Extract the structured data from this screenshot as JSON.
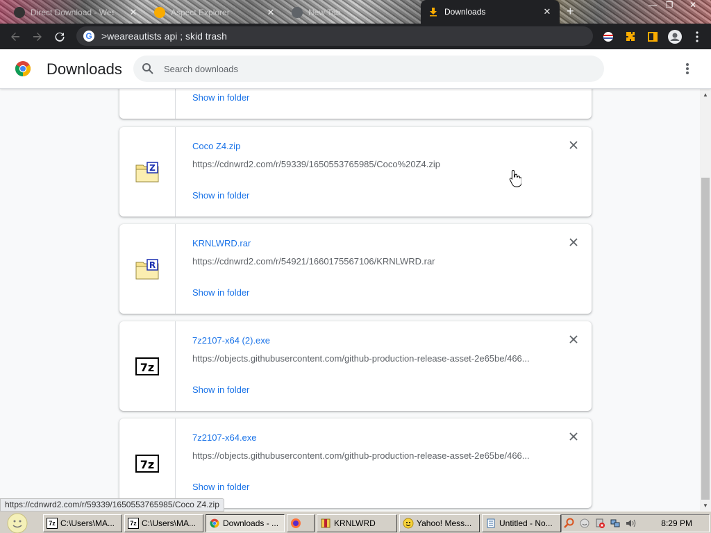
{
  "tabs": [
    {
      "title": "Direct Download - Wes",
      "favicon_color": "#333333",
      "active": false
    },
    {
      "title": "Aspect Explorer",
      "favicon_color": "#f9ab00",
      "active": false
    },
    {
      "title": "New Tab",
      "favicon_color": "#5f6368",
      "active": false
    },
    {
      "title": "Downloads",
      "favicon_color": "#f9ab00",
      "active": true
    }
  ],
  "toolbar": {
    "url": ">weareautists api ; skid trash"
  },
  "header": {
    "title": "Downloads",
    "search_placeholder": "Search downloads"
  },
  "downloads": [
    {
      "name": "",
      "url": "",
      "show_in_folder": "Show in folder",
      "icon": "none"
    },
    {
      "name": "Coco Z4.zip",
      "url": "https://cdnwrd2.com/r/59339/1650553765985/Coco%20Z4.zip",
      "show_in_folder": "Show in folder",
      "icon": "zip-icon",
      "icon_letter": "Z"
    },
    {
      "name": "KRNLWRD.rar",
      "url": "https://cdnwrd2.com/r/54921/1660175567106/KRNLWRD.rar",
      "show_in_folder": "Show in folder",
      "icon": "rar-icon",
      "icon_letter": "R"
    },
    {
      "name": "7z2107-x64 (2).exe",
      "url": "https://objects.githubusercontent.com/github-production-release-asset-2e65be/466...",
      "show_in_folder": "Show in folder",
      "icon": "7zip-icon",
      "icon_letter": "7z"
    },
    {
      "name": "7z2107-x64.exe",
      "url": "https://objects.githubusercontent.com/github-production-release-asset-2e65be/466...",
      "show_in_folder": "Show in folder",
      "icon": "7zip-icon",
      "icon_letter": "7z"
    }
  ],
  "status_bubble": "https://cdnwrd2.com/r/59339/1650553765985/Coco Z4.zip",
  "taskbar": {
    "buttons": [
      {
        "label": "C:\\Users\\MA...",
        "icon": "7zip-icon"
      },
      {
        "label": "C:\\Users\\MA...",
        "icon": "7zip-icon"
      },
      {
        "label": "Downloads - ...",
        "icon": "chrome-icon"
      },
      {
        "label": "",
        "icon": "firefox-icon"
      },
      {
        "label": "KRNLWRD",
        "icon": "archive-icon"
      },
      {
        "label": "Yahoo! Mess...",
        "icon": "yahoo-messenger-icon"
      },
      {
        "label": "Untitled - No...",
        "icon": "notepad-icon"
      }
    ],
    "clock": "8:29 PM"
  },
  "colors": {
    "link": "#1a73e8",
    "chrome_dark": "#202124",
    "taskbar": "#d4d0c8"
  }
}
